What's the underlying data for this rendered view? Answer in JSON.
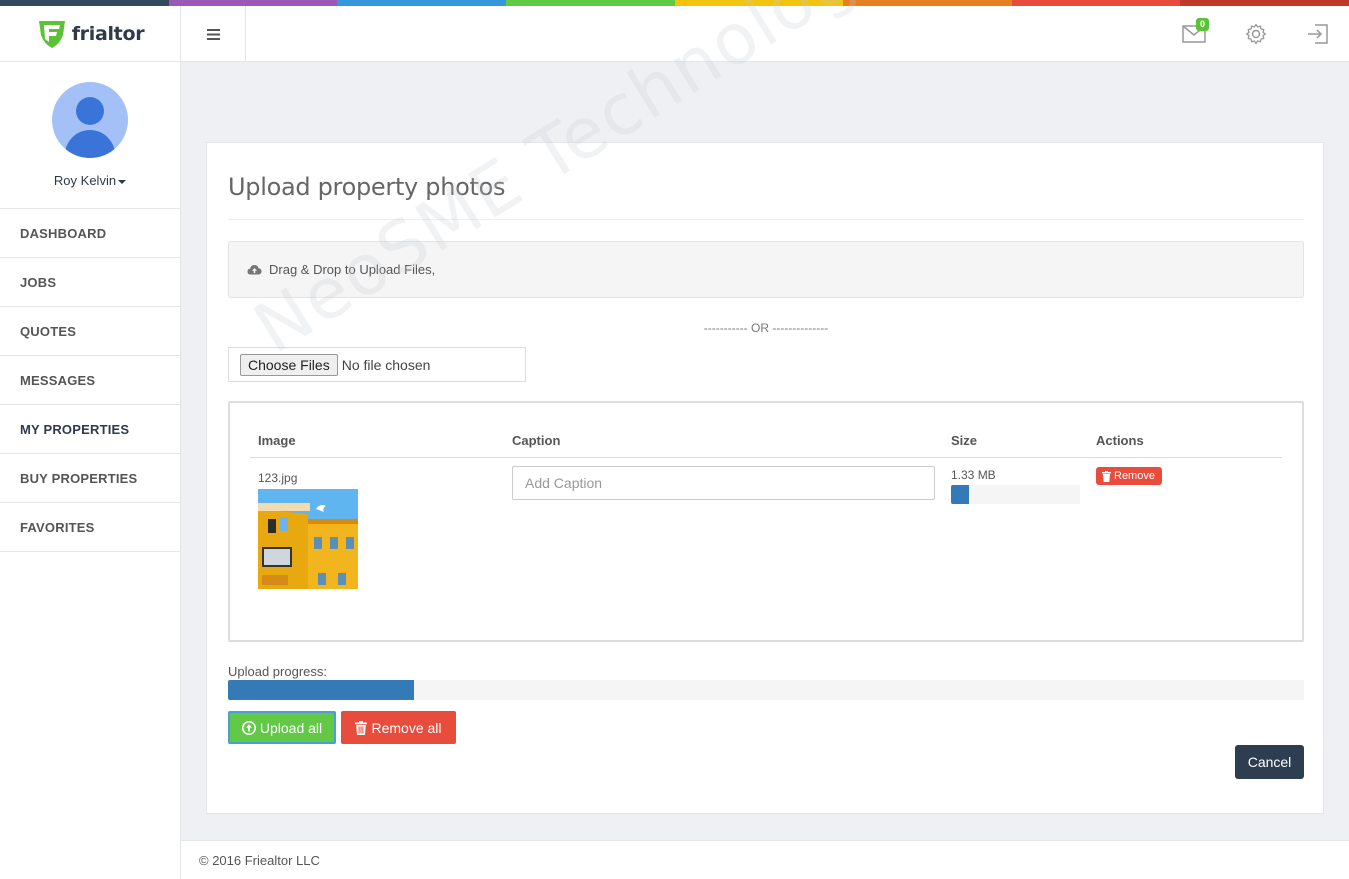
{
  "colors": {
    "strip": [
      "#34495e",
      "#9b59b6",
      "#3498db",
      "#62c946",
      "#f1c40f",
      "#e67e22",
      "#e74c3c",
      "#c0392b"
    ],
    "primary_blue": "#337ab7",
    "success_green": "#62c946",
    "danger_red": "#e74c3c",
    "dark_navy": "#2c3e50"
  },
  "header": {
    "logo": "frialtor",
    "menu_icon": "hamburger-icon",
    "mail_badge": "0",
    "icons": [
      "mail-icon",
      "gear-icon",
      "logout-icon"
    ]
  },
  "sidebar": {
    "user_name": "Roy Kelvin",
    "items": [
      {
        "label": "DASHBOARD"
      },
      {
        "label": "JOBS"
      },
      {
        "label": "QUOTES"
      },
      {
        "label": "MESSAGES"
      },
      {
        "label": "MY PROPERTIES"
      },
      {
        "label": "BUY PROPERTIES"
      },
      {
        "label": "FAVORITES"
      }
    ]
  },
  "main": {
    "title": "Upload property photos",
    "dropzone_text": "Drag & Drop to Upload Files,",
    "or_text": "----------- OR --------------",
    "file_input": {
      "button_label": "Choose Files",
      "status": "No file chosen"
    },
    "table": {
      "headers": {
        "image": "Image",
        "caption": "Caption",
        "size": "Size",
        "actions": "Actions"
      },
      "rows": [
        {
          "file_name": "123.jpg",
          "caption_placeholder": "Add Caption",
          "size": "1.33 MB",
          "progress_percent": 14,
          "remove_label": "Remove"
        }
      ]
    },
    "upload_progress_label": "Upload progress:",
    "upload_progress_percent": 17.3,
    "buttons": {
      "upload_all": "Upload all",
      "remove_all": "Remove all",
      "cancel": "Cancel"
    },
    "watermark": "NeoSME Technologies"
  },
  "footer": {
    "copyright": "© 2016 Friealtor LLC"
  }
}
